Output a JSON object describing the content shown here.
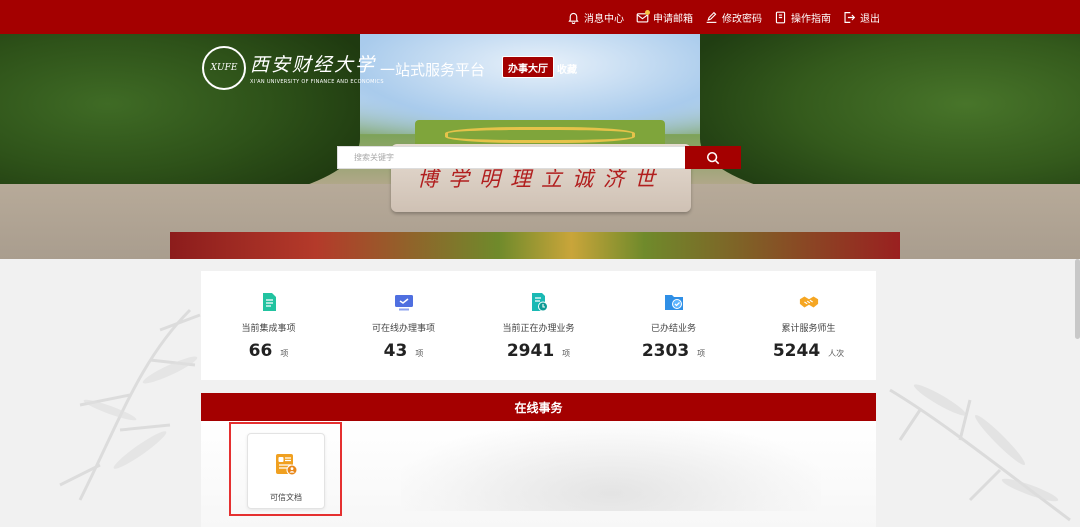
{
  "topbar": {
    "links": [
      {
        "label": "消息中心",
        "icon": "bell-icon"
      },
      {
        "label": "申请邮箱",
        "icon": "mail-icon"
      },
      {
        "label": "修改密码",
        "icon": "edit-password-icon"
      },
      {
        "label": "操作指南",
        "icon": "book-icon"
      },
      {
        "label": "退出",
        "icon": "logout-icon"
      }
    ]
  },
  "banner": {
    "logo_text": "XUFE",
    "logo_cn": "西安财经大学",
    "logo_en": "XI'AN UNIVERSITY OF FINANCE AND ECONOMICS",
    "platform_title": "一站式服务平台",
    "hall_button": "办事大厅",
    "favorite_link": "收藏",
    "motto": "博学明理立诚济世",
    "search_placeholder": "搜索关键字"
  },
  "stats": [
    {
      "label": "当前集成事项",
      "value": "66",
      "unit": "项",
      "icon": "document-list-icon",
      "color": "#22c3a0"
    },
    {
      "label": "可在线办理事项",
      "value": "43",
      "unit": "项",
      "icon": "monitor-icon",
      "color": "#4f6fe0"
    },
    {
      "label": "当前正在办理业务",
      "value": "2941",
      "unit": "项",
      "icon": "doc-progress-icon",
      "color": "#1ab9b4"
    },
    {
      "label": "已办结业务",
      "value": "2303",
      "unit": "项",
      "icon": "folder-check-icon",
      "color": "#2f8fe6"
    },
    {
      "label": "累计服务师生",
      "value": "5244",
      "unit": "人次",
      "icon": "handshake-icon",
      "color": "#f5a623"
    }
  ],
  "online": {
    "title": "在线事务",
    "items": [
      {
        "label": "可信文档",
        "icon": "trusted-document-icon",
        "color": "#f0a020"
      }
    ]
  },
  "colors": {
    "brand_red": "#a40000",
    "highlight_red": "#e53030"
  }
}
